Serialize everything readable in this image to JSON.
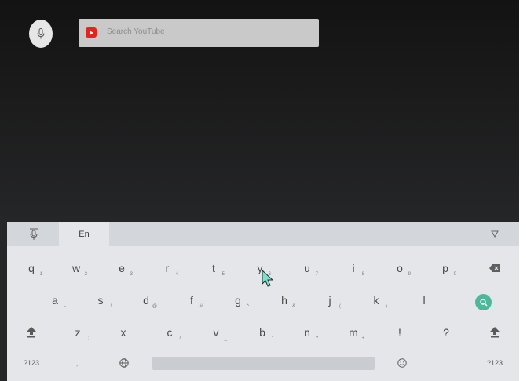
{
  "search": {
    "placeholder": "Search YouTube"
  },
  "keyboard": {
    "language_tab": "En",
    "rows": [
      [
        {
          "label": "q",
          "hint": "1"
        },
        {
          "label": "w",
          "hint": "2"
        },
        {
          "label": "e",
          "hint": "3"
        },
        {
          "label": "r",
          "hint": "4"
        },
        {
          "label": "t",
          "hint": "5"
        },
        {
          "label": "y",
          "hint": "6"
        },
        {
          "label": "u",
          "hint": "7"
        },
        {
          "label": "i",
          "hint": "8"
        },
        {
          "label": "o",
          "hint": "9"
        },
        {
          "label": "p",
          "hint": "0"
        }
      ],
      [
        {
          "label": "a",
          "hint": "-"
        },
        {
          "label": "s",
          "hint": "!"
        },
        {
          "label": "d",
          "hint": "@"
        },
        {
          "label": "f",
          "hint": "#"
        },
        {
          "label": "g",
          "hint": "^"
        },
        {
          "label": "h",
          "hint": "&"
        },
        {
          "label": "j",
          "hint": "("
        },
        {
          "label": "k",
          "hint": ")"
        },
        {
          "label": "l",
          "hint": "."
        }
      ],
      [
        {
          "label": "z",
          "hint": ";"
        },
        {
          "label": "x",
          "hint": ":"
        },
        {
          "label": "c",
          "hint": "/"
        },
        {
          "label": "v",
          "hint": "_"
        },
        {
          "label": "b",
          "hint": "\""
        },
        {
          "label": "n",
          "hint": "?"
        },
        {
          "label": "m",
          "hint": "+"
        },
        {
          "label": "!",
          "hint": ""
        },
        {
          "label": "?",
          "hint": ""
        }
      ]
    ],
    "bottom": {
      "symbols_left": "?123",
      "comma": ",",
      "period": ".",
      "symbols_right": "?123"
    }
  },
  "colors": {
    "accent": "#4cb89a",
    "youtube_red": "#e22420",
    "keyboard_bg": "#e4e6e9"
  },
  "icons": [
    "mic-icon",
    "youtube-icon",
    "collapse-icon",
    "backspace-icon",
    "shift-icon",
    "globe-icon",
    "emoji-icon",
    "search-icon",
    "mouse-cursor"
  ]
}
